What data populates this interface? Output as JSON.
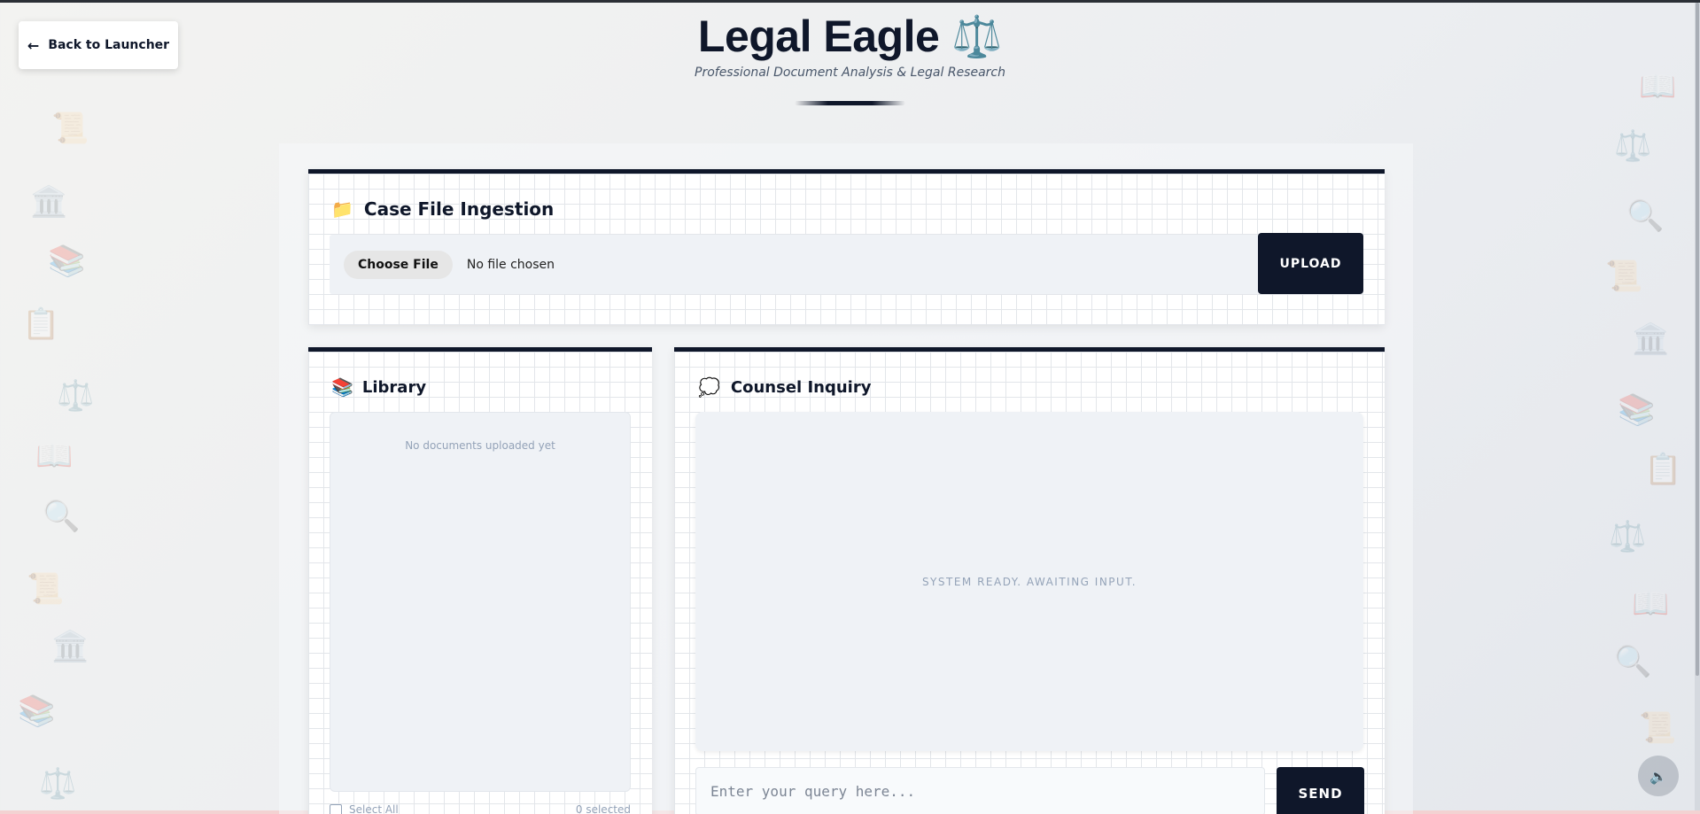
{
  "launcher": {
    "back_label": "Back to Launcher",
    "arrow_icon": "←"
  },
  "header": {
    "title": "Legal Eagle",
    "title_icon": "⚖️",
    "subtitle": "Professional Document Analysis & Legal Research"
  },
  "ingestion": {
    "icon": "📁",
    "title": "Case File Ingestion",
    "choose_label": "Choose File",
    "file_status": "No file chosen",
    "upload_label": "UPLOAD"
  },
  "library": {
    "icon": "📚",
    "title": "Library",
    "empty_text": "No documents uploaded yet",
    "select_all_label": "Select All",
    "selected_count": "0 selected"
  },
  "counsel": {
    "icon": "💭",
    "title": "Counsel Inquiry",
    "status_text": "SYSTEM READY. AWAITING INPUT.",
    "input_placeholder": "Enter your query here...",
    "input_value": "",
    "send_label": "SEND"
  },
  "audio": {
    "icon": "🔈"
  },
  "background_icons": {
    "scroll": "📜",
    "courthouse": "🏛️",
    "books": "📚",
    "clipboard": "📋",
    "scales": "⚖️",
    "open_book": "📖",
    "magnifier": "🔍"
  },
  "colors": {
    "primary_dark": "#0f172a",
    "panel_fill": "#eff2f6",
    "muted_text": "#94a3b8"
  }
}
